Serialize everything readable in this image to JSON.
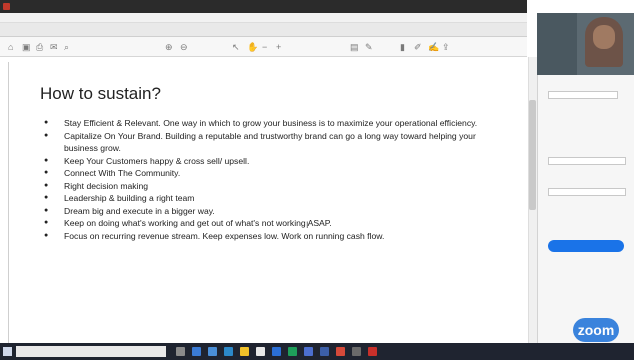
{
  "app": {
    "title": "",
    "menu": [],
    "tabs": []
  },
  "slide": {
    "heading": "How to sustain?",
    "bullets": [
      "Stay Efficient & Relevant. One way in which to grow your business is to maximize your operational efficiency.",
      "Capitalize On Your Brand. Building a reputable and trustworthy brand can go a long way toward helping your business grow.",
      "Keep Your Customers happy & cross sell/ upsell.",
      "Connect With The Community.",
      "Right decision making",
      "Leadership & building a right team",
      "Dream big and execute in a bigger way.",
      "Keep on doing what's working and get out of what's not working ASAP.",
      "Focus on recurring revenue stream. Keep expenses low. Work on running cash flow."
    ]
  },
  "video": {
    "participant_name": ""
  },
  "panel": {
    "convert_label": ""
  },
  "watermark": {
    "text": "zoom"
  },
  "colors": {
    "titlebar": "#2b2b2b",
    "taskbar": "#1f2430",
    "accent": "#1a73e8"
  },
  "icons": [
    "search-icon",
    "print-icon",
    "save-icon",
    "zoom-in-icon",
    "zoom-out-icon",
    "cursor-icon",
    "highlight-icon",
    "pen-icon",
    "comment-icon",
    "windows-start-icon"
  ]
}
